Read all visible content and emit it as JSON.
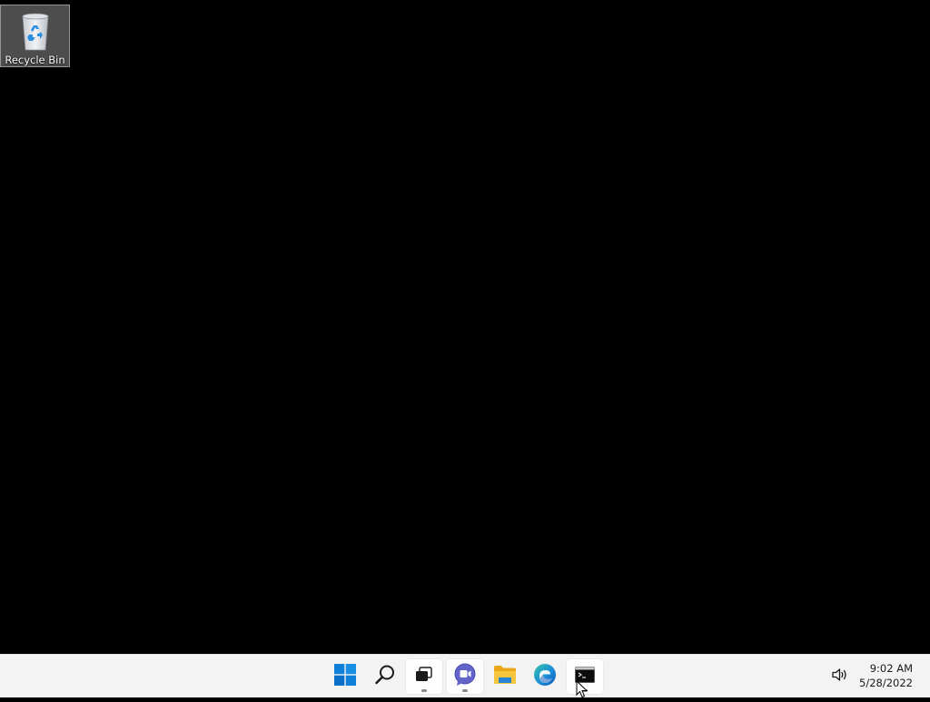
{
  "desktop": {
    "background": "#000000",
    "icons": [
      {
        "label": "Recycle Bin",
        "icon": "recycle-bin-icon"
      }
    ]
  },
  "taskbar": {
    "background": "#f3f3f3",
    "apps": [
      {
        "id": "start",
        "icon": "windows-start-icon",
        "accent": "#0078d4",
        "active": false
      },
      {
        "id": "search",
        "icon": "search-icon",
        "active": false
      },
      {
        "id": "task-view",
        "icon": "task-view-icon",
        "active": true
      },
      {
        "id": "chat",
        "icon": "teams-chat-icon",
        "accent": "#5b5fc7",
        "active": true
      },
      {
        "id": "file-explorer",
        "icon": "folder-icon",
        "accent": "#f8c13a",
        "active": false
      },
      {
        "id": "edge",
        "icon": "edge-browser-icon",
        "accent": "#1e90c8",
        "active": false
      },
      {
        "id": "terminal",
        "icon": "command-prompt-icon",
        "active": true
      }
    ],
    "tray": {
      "volume_icon": "volume-icon",
      "time": "9:02 AM",
      "date": "5/28/2022"
    }
  }
}
